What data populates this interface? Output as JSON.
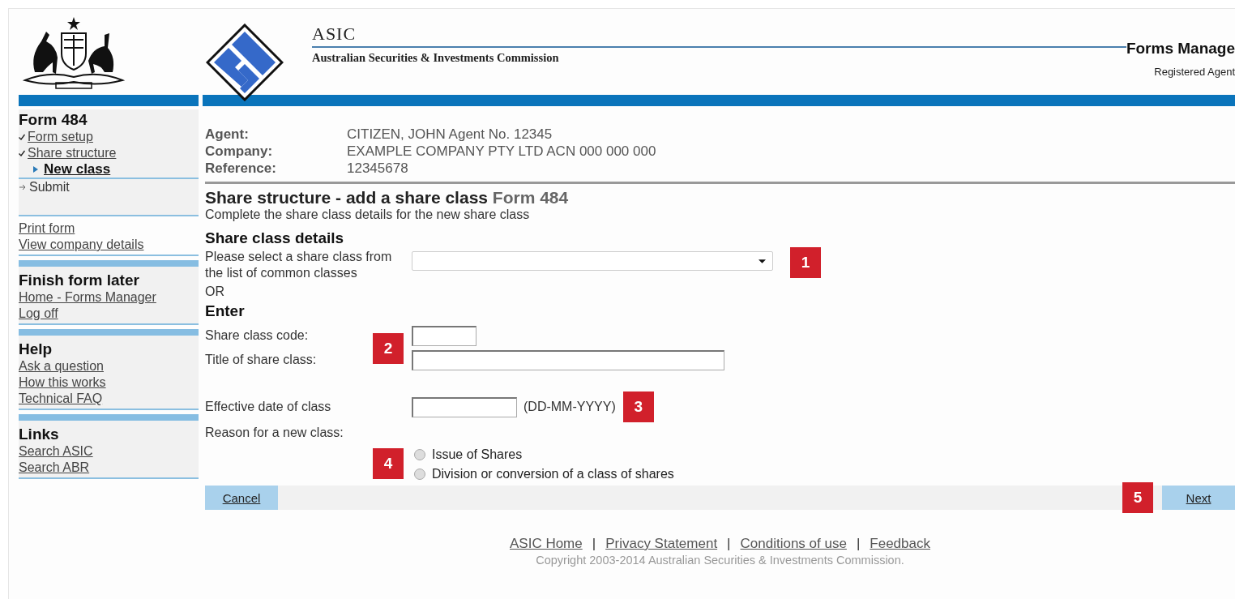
{
  "header": {
    "agency": "ASIC",
    "commission": "Australian Securities & Investments Commission",
    "product": "Forms Manage",
    "subtitle": "Registered Agent"
  },
  "sidebar": {
    "form_title": "Form 484",
    "steps": [
      {
        "label": "Form setup",
        "checked": true
      },
      {
        "label": "Share structure",
        "checked": true,
        "children": [
          {
            "label": "New class",
            "current": true
          }
        ]
      },
      {
        "label": "Submit",
        "checked": false
      }
    ],
    "tools": [
      "Print form",
      "View company details"
    ],
    "sections": [
      {
        "title": "Finish form later",
        "links": [
          "Home - Forms Manager",
          "Log off"
        ]
      },
      {
        "title": "Help",
        "links": [
          "Ask a question",
          "How this works",
          "Technical FAQ"
        ]
      },
      {
        "title": "Links",
        "links": [
          "Search ASIC",
          "Search ABR"
        ]
      }
    ]
  },
  "details": [
    {
      "label": "Agent:",
      "value": "CITIZEN, JOHN Agent No. 12345"
    },
    {
      "label": "Company:",
      "value": "EXAMPLE COMPANY PTY LTD ACN 000 000 000"
    },
    {
      "label": "Reference:",
      "value": "12345678"
    }
  ],
  "page": {
    "title": "Share structure - add a share class",
    "form_label": "Form 484",
    "intro": "Complete the share class details for the new share class",
    "section": "Share class details"
  },
  "form": {
    "select_label": "Please select a share class from the list of common classes",
    "or": "OR",
    "enter": "Enter",
    "code_label": "Share class code:",
    "title_label": "Title of share class:",
    "date_label": "Effective date of class",
    "date_hint": "(DD-MM-YYYY)",
    "reason_label": "Reason for a new class:",
    "reasons": [
      {
        "label": "Issue of Shares",
        "selected": false
      },
      {
        "label": "Division or conversion of a class of shares",
        "selected": false
      }
    ]
  },
  "buttons": {
    "cancel": "Cancel",
    "next": "Next"
  },
  "callouts": [
    "1",
    "2",
    "3",
    "4",
    "5"
  ],
  "footer": {
    "links": [
      "ASIC Home",
      "Privacy Statement",
      "Conditions of use",
      "Feedback"
    ],
    "separator": "|",
    "copyright": "Copyright 2003-2014 Australian Securities & Investments Commission."
  }
}
